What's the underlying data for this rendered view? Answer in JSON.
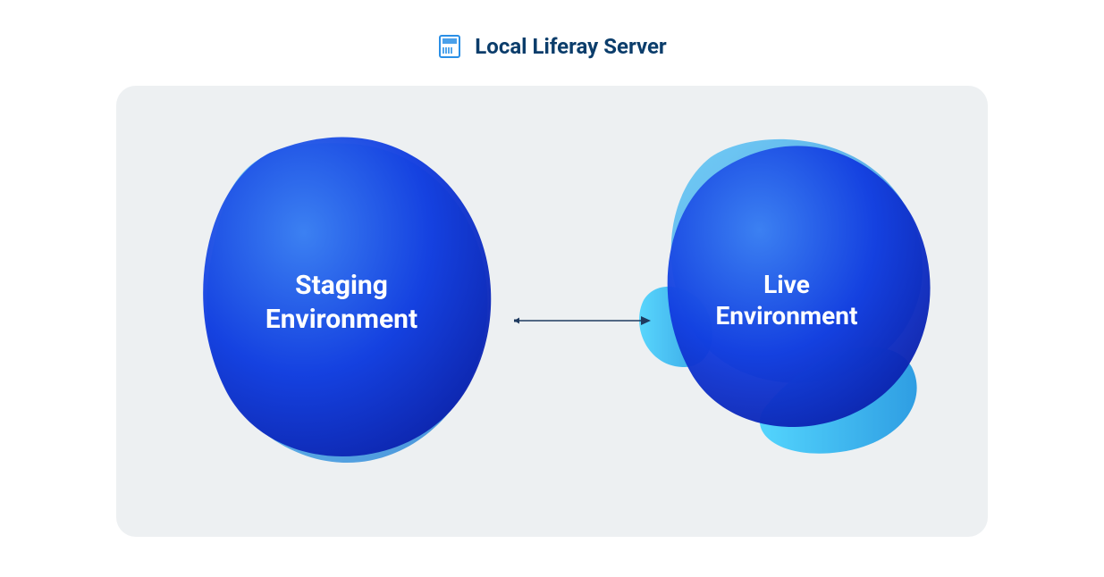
{
  "header": {
    "title": "Local Liferay Server",
    "icon": "server-icon"
  },
  "diagram": {
    "nodes": [
      {
        "id": "staging",
        "label_line1": "Staging",
        "label_line2": "Environment"
      },
      {
        "id": "live",
        "label_line1": "Live",
        "label_line2": "Environment"
      }
    ],
    "edges": [
      {
        "from": "staging",
        "to": "live",
        "direction": "right"
      }
    ]
  },
  "colors": {
    "title": "#0b3d6b",
    "panel_bg": "#edf0f2",
    "blob_dark": "#0d2bc9",
    "blob_mid": "#1a6ae8",
    "blob_light": "#33aef5",
    "arrow": "#1e3a5f"
  }
}
